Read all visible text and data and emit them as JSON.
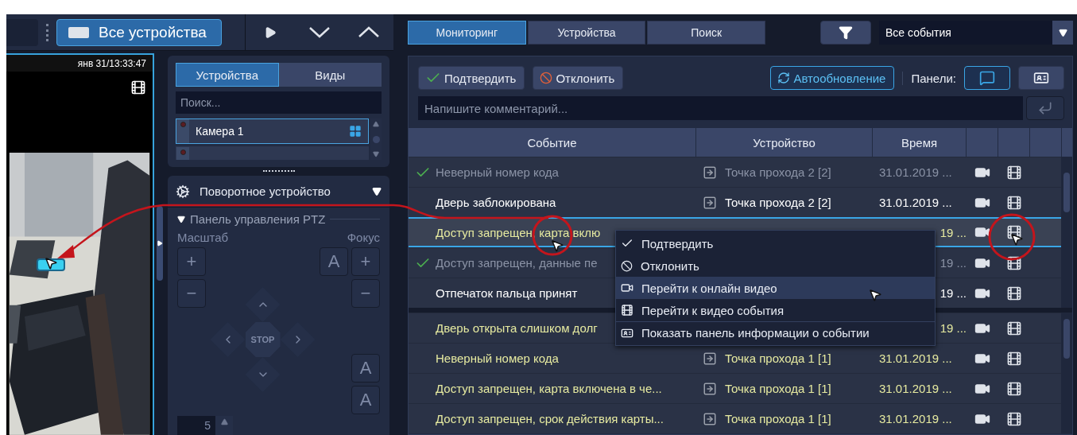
{
  "top_bar": {
    "view_button": "Все устройства"
  },
  "video": {
    "timestamp": "янв 31/13:33:47"
  },
  "device_panel": {
    "tabs": [
      {
        "label": "Устройства",
        "selected": true
      },
      {
        "label": "Виды",
        "selected": false
      }
    ],
    "search": {
      "placeholder": "Поиск..."
    },
    "cameras": [
      {
        "name": "Камера 1",
        "selected": true
      },
      {
        "selected": false
      }
    ]
  },
  "ptz": {
    "title": "Поворотное устройство",
    "subtitle": "Панель управления PTZ",
    "disabled": true,
    "zoom_label": "Масштаб",
    "focus_label": "Фокус",
    "zoom_buttons": [
      "+",
      "−"
    ],
    "focus_buttons": [
      "A",
      "+",
      "−"
    ],
    "stop": "STOP",
    "iris_buttons": [
      "A",
      "A"
    ],
    "speed": "5"
  },
  "tabs": [
    {
      "label": "Мониторинг",
      "selected": true
    },
    {
      "label": "Устройства",
      "selected": false
    },
    {
      "label": "Поиск",
      "selected": false
    }
  ],
  "event_filter": {
    "value": "Все события"
  },
  "toolbar": {
    "confirm": "Подтвердить",
    "reject": "Отклонить",
    "auto_refresh": {
      "label": "Автообновление",
      "on": true
    },
    "panels_label": "Панели:",
    "panels": [
      {
        "kind": "comments",
        "on": true
      },
      {
        "kind": "info",
        "on": false
      }
    ]
  },
  "comment": {
    "placeholder": "Напишите комментарий..."
  },
  "table": {
    "columns": [
      "Событие",
      "Устройство",
      "Время"
    ],
    "sections": [
      [
        {
          "event": "Неверный номер кода",
          "device": "Точка прохода 2 [2]",
          "time": "31.01.2019 ...",
          "confirmed": true,
          "color": "#8b93a6",
          "selected": false
        },
        {
          "event": "Дверь заблокирована",
          "device": "Точка прохода 2 [2]",
          "time": "31.01.2019 ...",
          "confirmed": false,
          "color": "#ffffff",
          "selected": false
        },
        {
          "event": "Доступ запрещен, карта вклю",
          "time": "19 ...",
          "confirmed": false,
          "color": "#e6eaa0",
          "selected": true
        },
        {
          "event": "Доступ запрещен, данные пе",
          "time": "19 ...",
          "confirmed": true,
          "color": "#8b93a6",
          "selected": false
        },
        {
          "event": "Отпечаток пальца принят",
          "time": "19 ...",
          "confirmed": false,
          "color": "#ffffff",
          "selected": false
        }
      ],
      [
        {
          "event": "Дверь открыта слишком долг",
          "time": "19 ...",
          "confirmed": false,
          "color": "#e6eaa0",
          "selected": false
        },
        {
          "event": "Неверный номер кода",
          "device": "Точка прохода 1 [1]",
          "time": "31.01.2019 ...",
          "confirmed": false,
          "color": "#e6eaa0",
          "selected": false
        },
        {
          "event": "Доступ запрещен, карта включена в че...",
          "device": "Точка прохода 1 [1]",
          "time": "31.01.2019 ...",
          "confirmed": false,
          "color": "#e6eaa0",
          "selected": false
        },
        {
          "event": "Доступ запрещен, срок действия карты...",
          "device": "Точка прохода 1 [1]",
          "time": "31.01.2019 ...",
          "confirmed": false,
          "color": "#e6eaa0",
          "selected": false
        }
      ]
    ]
  },
  "context_menu": [
    {
      "kind": "confirm",
      "label": "Подтвердить",
      "selected": false
    },
    {
      "kind": "reject",
      "label": "Отклонить",
      "selected": false
    },
    {
      "kind": "live",
      "label": "Перейти к онлайн видео",
      "selected": true
    },
    {
      "kind": "archive",
      "label": "Перейти к видео события",
      "selected": false
    },
    {
      "kind": "info",
      "label": "Показать панель информации о событии",
      "selected": false
    }
  ]
}
